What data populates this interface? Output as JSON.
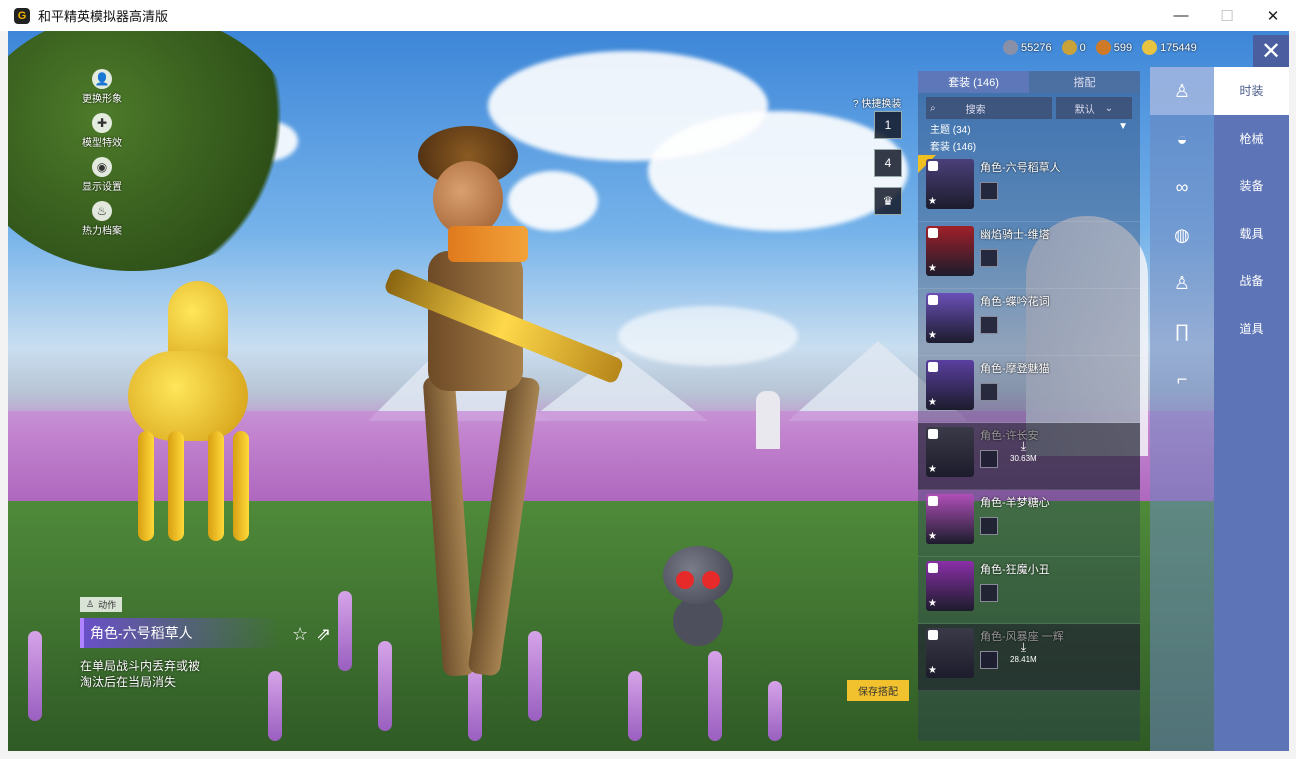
{
  "window": {
    "title": "和平精英模拟器高清版",
    "app_icon": "G",
    "controls": {
      "minimize": "—",
      "maximize": "☐",
      "close": "✕"
    }
  },
  "left_menu": [
    {
      "label": "更换形象",
      "icon": "person-icon"
    },
    {
      "label": "模型特效",
      "icon": "puzzle-icon"
    },
    {
      "label": "显示设置",
      "icon": "eye-icon"
    },
    {
      "label": "热力档案",
      "icon": "flame-icon"
    }
  ],
  "currency": [
    {
      "value": "55276",
      "color": "#8a8fa8"
    },
    {
      "value": "0",
      "color": "#c9a23a"
    },
    {
      "value": "599",
      "color": "#d07a28"
    },
    {
      "value": "175449",
      "color": "#e8c440"
    }
  ],
  "close_button": "✕",
  "quick_swap": {
    "label": "快捷换装",
    "help": "?",
    "slots": [
      "1",
      "4",
      "♛"
    ]
  },
  "outfit_panel": {
    "tabs": [
      "套装 (146)",
      "搭配"
    ],
    "search_placeholder": "搜索",
    "sort_label": "默认",
    "theme_label": "主题 (34)",
    "theme_arrow": "▼",
    "count_label": "套装 (146)",
    "items": [
      {
        "name": "角色-六号稻草人",
        "selected": true,
        "dim": false,
        "color": "#4b3f7a",
        "download": ""
      },
      {
        "name": "幽焰骑士-维塔",
        "selected": false,
        "dim": false,
        "color": "#a0202a",
        "download": ""
      },
      {
        "name": "角色-蝶吟花词",
        "selected": false,
        "dim": false,
        "color": "#6a50b8",
        "download": ""
      },
      {
        "name": "角色-摩登魅猫",
        "selected": false,
        "dim": false,
        "color": "#5a3fa0",
        "download": ""
      },
      {
        "name": "角色-许长安",
        "selected": false,
        "dim": true,
        "color": "#3a3a48",
        "download": "30.63M"
      },
      {
        "name": "角色-羊梦糖心",
        "selected": false,
        "dim": false,
        "color": "#b04fb8",
        "download": ""
      },
      {
        "name": "角色-狂魔小丑",
        "selected": false,
        "dim": false,
        "color": "#8a2fa8",
        "download": ""
      },
      {
        "name": "角色-风暴座 一辉",
        "selected": false,
        "dim": true,
        "color": "#3a3a48",
        "download": "28.41M"
      }
    ]
  },
  "category_icons": [
    "figure-icon",
    "cap-icon",
    "goggles-icon",
    "mask-icon",
    "outfit-icon",
    "pants-icon",
    "shoes-icon"
  ],
  "right_menu": [
    "时装",
    "枪械",
    "装备",
    "载具",
    "战备",
    "道具"
  ],
  "bottom": {
    "action_tag": "动作",
    "outfit_name": "角色-六号稻草人",
    "favorite_icon": "☆",
    "share_icon": "⇗",
    "description_line1": "在单局战斗内丢弃或被",
    "description_line2": "淘汰后在当局消失"
  },
  "save_button": "保存搭配"
}
